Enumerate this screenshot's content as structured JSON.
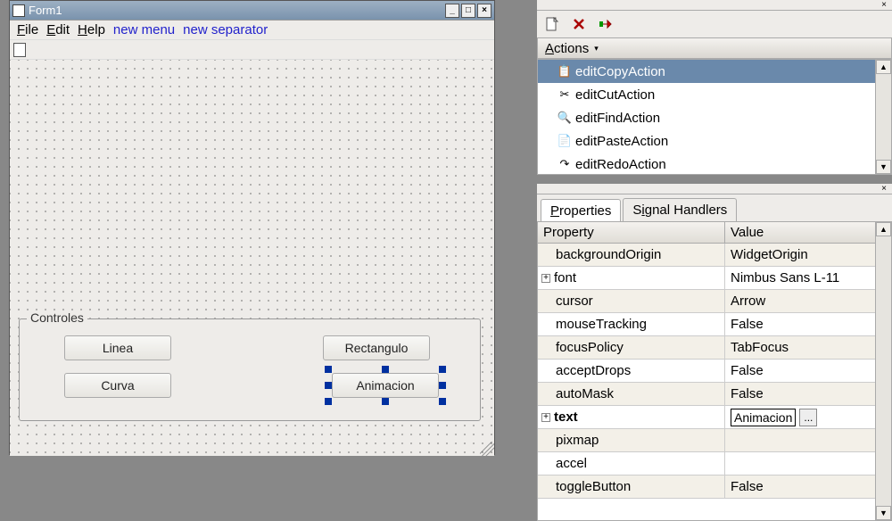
{
  "form": {
    "title": "Form1",
    "menus": {
      "file": "File",
      "edit": "Edit",
      "help": "Help"
    },
    "new_menu_label": "new menu",
    "new_separator_label": "new separator",
    "controls_legend": "Controles",
    "buttons": {
      "linea": "Linea",
      "curva": "Curva",
      "rectangulo": "Rectangulo",
      "animacion": "Animacion"
    }
  },
  "actions": {
    "header": "Actions",
    "items": [
      {
        "label": "editCopyAction",
        "icon": "📋",
        "selected": true
      },
      {
        "label": "editCutAction",
        "icon": "✂",
        "selected": false
      },
      {
        "label": "editFindAction",
        "icon": "🔍",
        "selected": false
      },
      {
        "label": "editPasteAction",
        "icon": "📄",
        "selected": false
      },
      {
        "label": "editRedoAction",
        "icon": "↷",
        "selected": false
      }
    ]
  },
  "property_tabs": {
    "properties": "Properties",
    "signals": "Signal Handlers"
  },
  "property_grid": {
    "header_property": "Property",
    "header_value": "Value",
    "rows": [
      {
        "name": "backgroundOrigin",
        "value": "WidgetOrigin",
        "odd": true
      },
      {
        "name": "font",
        "value": "Nimbus Sans L-11",
        "expand": "+"
      },
      {
        "name": "cursor",
        "value": "Arrow",
        "odd": true
      },
      {
        "name": "mouseTracking",
        "value": "False"
      },
      {
        "name": "focusPolicy",
        "value": "TabFocus",
        "odd": true
      },
      {
        "name": "acceptDrops",
        "value": "False"
      },
      {
        "name": "autoMask",
        "value": "False",
        "odd": true
      },
      {
        "name": "text",
        "value": "Animacion",
        "bold": true,
        "expand": "+",
        "editing": true
      },
      {
        "name": "pixmap",
        "value": "",
        "odd": true
      },
      {
        "name": "accel",
        "value": ""
      },
      {
        "name": "toggleButton",
        "value": "False",
        "odd": true
      }
    ]
  }
}
